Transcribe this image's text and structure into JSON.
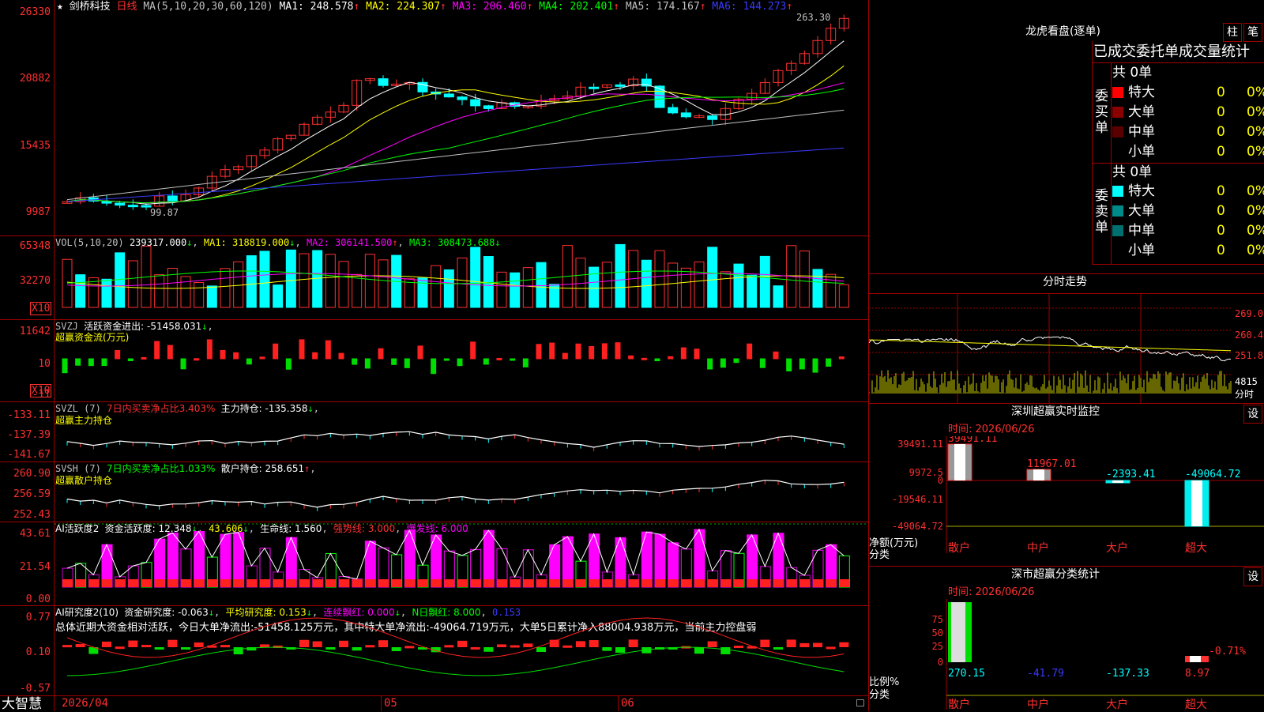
{
  "main": {
    "star": "★",
    "stock_name": "剑桥科技",
    "period": "日线",
    "ma_params": "MA(5,10,20,30,60,120)",
    "ma": [
      {
        "label": "MA1:",
        "value": "248.578",
        "color": "#ffffff"
      },
      {
        "label": "MA2:",
        "value": "224.307",
        "color": "#ffff00"
      },
      {
        "label": "MA3:",
        "value": "206.460",
        "color": "#ff00ff"
      },
      {
        "label": "MA4:",
        "value": "202.401",
        "color": "#00ff00"
      },
      {
        "label": "MA5:",
        "value": "174.167",
        "color": "#c0c0c0"
      },
      {
        "label": "MA6:",
        "value": "144.273",
        "color": "#3a3aff"
      }
    ],
    "arrow_up": "↑",
    "yaxis": [
      "26330",
      "20882",
      "15435",
      "9987"
    ],
    "high_marker": "263.30",
    "low_marker": "99.87"
  },
  "vol": {
    "title": "VOL(5,10,20)",
    "value": "239317.000",
    "ma1": "MA1: 318819.000",
    "ma2": "MA2: 306141.500",
    "ma3": "MA3: 308473.688",
    "yaxis": [
      "65348",
      "32270"
    ],
    "unit": "X10"
  },
  "svzj": {
    "title": "SVZJ",
    "label": "活跃资金进出: -51458.031",
    "subtitle": "超赢资金流(万元)",
    "yaxis": [
      "11642",
      "10",
      "-11"
    ],
    "unit": "X10"
  },
  "svzl": {
    "title": "SVZL (7)",
    "ratio": "7日内买卖净占比3.403%",
    "hold": "主力持仓: -135.358",
    "subtitle": "超赢主力持仓",
    "yaxis": [
      "-133.11",
      "-137.39",
      "-141.67"
    ]
  },
  "svsh": {
    "title": "SVSH (7)",
    "ratio": "7日内买卖净占比1.033%",
    "hold": "散户持仓: 258.651",
    "subtitle": "超赢散户持仓",
    "yaxis": [
      "260.90",
      "256.59",
      "252.43"
    ]
  },
  "ai_active": {
    "title": "AI活跃度2",
    "a": "资金活跃度: 12.348",
    "b": "43.606",
    "c": "生命线: 1.560",
    "d": "强势线: 3.000",
    "e": "爆发线: 6.000",
    "yaxis": [
      "43.61",
      "21.54",
      "0.00"
    ]
  },
  "ai_research": {
    "title": "AI研究度2(10)",
    "a": "资金研究度: -0.063",
    "b": "平均研究度: 0.153",
    "c": "连续飘红: 0.000",
    "d": "N日飘红: 8.000",
    "e": "0.153",
    "summary": "总体近期大资金相对活跃，今日大单净流出:-51458.125万元，其中特大单净流出:-49064.719万元，大单5日累计净入88004.938万元，当前主力控盘弱",
    "yaxis": [
      "0.77",
      "0.10",
      "-0.57"
    ]
  },
  "bottom": {
    "brand": "大智慧",
    "dates": [
      "2026/04",
      "05",
      "06"
    ],
    "lock_icon": "lock-icon"
  },
  "dragon": {
    "title": "龙虎看盘(逐单)",
    "btn_bar": "柱",
    "btn_pen": "笔",
    "header": "已成交委托单成交量统计",
    "buy": {
      "side": "委买单",
      "count": "共 0单",
      "rows": [
        {
          "name": "特大",
          "val": "0",
          "pct": "0%",
          "color": "#ff0000"
        },
        {
          "name": "大单",
          "val": "0",
          "pct": "0%",
          "color": "#8b0000"
        },
        {
          "name": "中单",
          "val": "0",
          "pct": "0%",
          "color": "#5a0000"
        },
        {
          "name": "小单",
          "val": "0",
          "pct": "0%",
          "color": "#000000"
        }
      ]
    },
    "sell": {
      "side": "委卖单",
      "count": "共 0单",
      "rows": [
        {
          "name": "特大",
          "val": "0",
          "pct": "0%",
          "color": "#00ffff"
        },
        {
          "name": "大单",
          "val": "0",
          "pct": "0%",
          "color": "#008b8b"
        },
        {
          "name": "中单",
          "val": "0",
          "pct": "0%",
          "color": "#006f6f"
        },
        {
          "name": "小单",
          "val": "0",
          "pct": "0%",
          "color": "#000000"
        }
      ]
    }
  },
  "intraday": {
    "title": "分时走势",
    "yaxis": [
      "269.0",
      "260.4",
      "251.8"
    ],
    "vol_label": "4815",
    "x_label": "分时"
  },
  "sz_monitor": {
    "title": "深圳超赢实时监控",
    "btn": "设",
    "time": "时间: 2026/06/26",
    "yaxis": [
      "39491.11",
      "9972.5",
      "0",
      "-19546.11",
      "-49064.72"
    ],
    "ylabel": "净额(万元)",
    "xlabel": "分类",
    "categories": [
      "散户",
      "中户",
      "大户",
      "超大"
    ],
    "values": [
      "39491.11",
      "11967.01",
      "-2393.41",
      "-49064.72"
    ]
  },
  "sz_class": {
    "title": "深市超赢分类统计",
    "btn": "设",
    "time": "时间: 2026/06/26",
    "yaxis": [
      "75",
      "50",
      "25",
      "0"
    ],
    "ylabel": "比例%",
    "xlabel": "分类",
    "categories": [
      "散户",
      "中户",
      "大户",
      "超大"
    ],
    "values": [
      "270.15",
      "-41.79",
      "-137.33",
      "8.97"
    ],
    "extra_label": "-0.71%"
  }
}
